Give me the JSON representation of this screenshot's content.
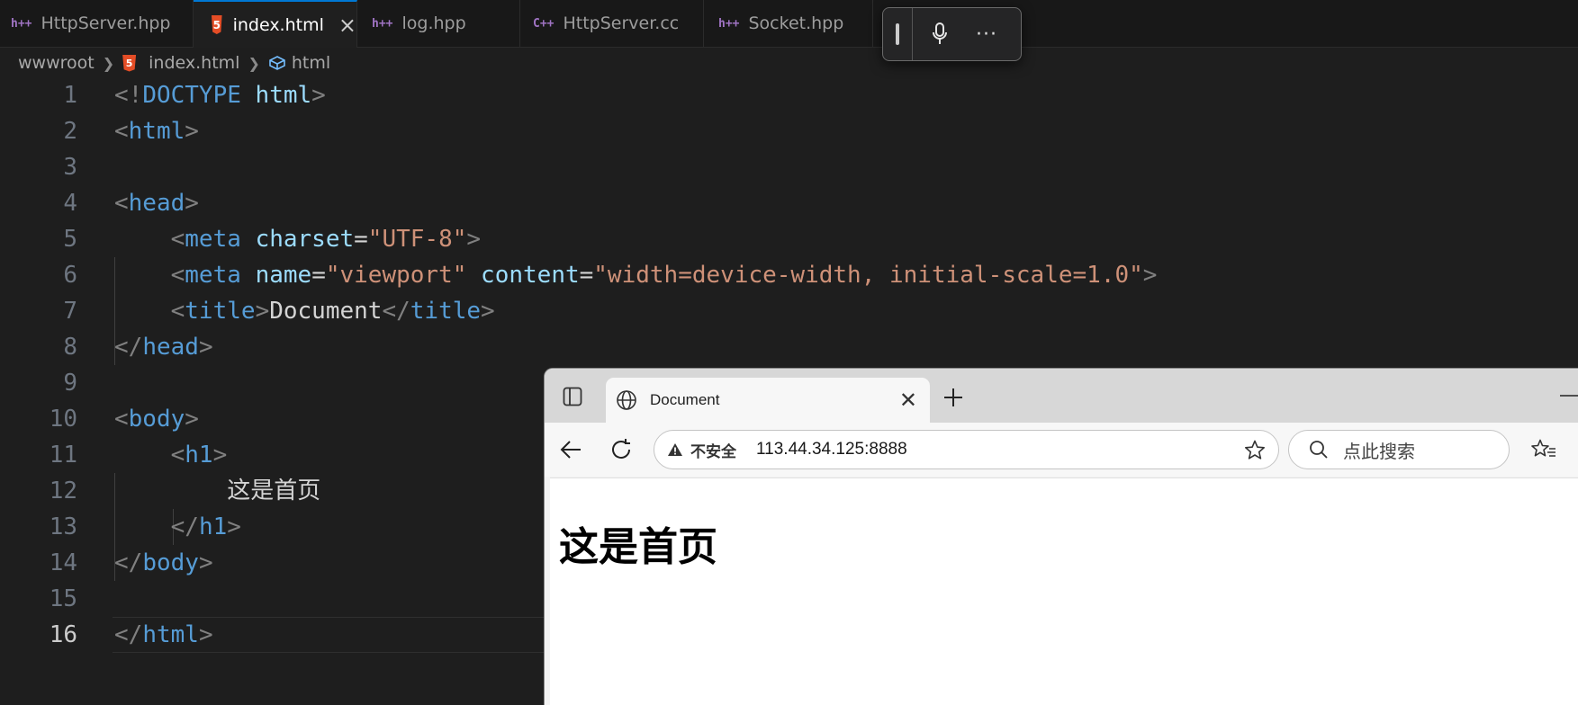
{
  "editor_tabs": [
    {
      "icon": "h++",
      "label": "HttpServer.hpp"
    },
    {
      "icon": "html5",
      "label": "index.html"
    },
    {
      "icon": "h++",
      "label": "log.hpp"
    },
    {
      "icon": "C++",
      "label": "HttpServer.cc"
    },
    {
      "icon": "h++",
      "label": "Socket.hpp"
    }
  ],
  "active_tab": "index.html",
  "breadcrumb": {
    "folder": "wwwroot",
    "file": "index.html",
    "symbol": "html"
  },
  "code_lines": [
    {
      "n": "1"
    },
    {
      "n": "2"
    },
    {
      "n": "3"
    },
    {
      "n": "4"
    },
    {
      "n": "5"
    },
    {
      "n": "6"
    },
    {
      "n": "7"
    },
    {
      "n": "8"
    },
    {
      "n": "9"
    },
    {
      "n": "10"
    },
    {
      "n": "11"
    },
    {
      "n": "12"
    },
    {
      "n": "13"
    },
    {
      "n": "14"
    },
    {
      "n": "15"
    },
    {
      "n": "16"
    }
  ],
  "code": {
    "doctype_open": "<!",
    "doctype_kw": "DOCTYPE",
    "doctype_val": "html",
    "gt": ">",
    "lt": "<",
    "lt_slash": "</",
    "tag_html": "html",
    "tag_head": "head",
    "tag_meta": "meta",
    "tag_title": "title",
    "tag_body": "body",
    "tag_h1": "h1",
    "attr_charset": "charset",
    "attr_name": "name",
    "attr_content": "content",
    "eq": "=",
    "val_charset": "\"UTF-8\"",
    "val_name": "\"viewport\"",
    "val_content": "\"width=device-width, initial-scale=1.0\"",
    "title_text": "Document",
    "h1_text": "这是首页"
  },
  "current_line": "16",
  "browser": {
    "tab_title": "Document",
    "security_label": "不安全",
    "url": "113.44.34.125:8888",
    "search_placeholder": "点此搜索",
    "page_heading": "这是首页"
  },
  "colors": {
    "accent": "#0078d4",
    "tag": "#569cd6",
    "attr": "#9cdcfe",
    "string": "#ce9178"
  }
}
